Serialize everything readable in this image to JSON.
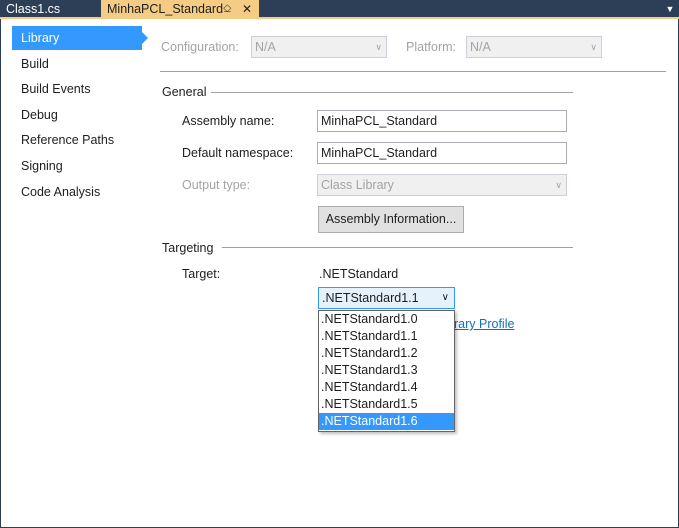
{
  "tabs": [
    {
      "label": "Class1.cs",
      "active": false
    },
    {
      "label": "MinhaPCL_Standard",
      "active": true
    }
  ],
  "icons": {
    "pin": "pin-icon",
    "close": "close-icon",
    "overflow": "chevron-down-icon"
  },
  "sidebar": {
    "items": [
      {
        "label": "Library",
        "selected": true
      },
      {
        "label": "Build"
      },
      {
        "label": "Build Events"
      },
      {
        "label": "Debug"
      },
      {
        "label": "Reference Paths"
      },
      {
        "label": "Signing"
      },
      {
        "label": "Code Analysis"
      }
    ]
  },
  "config": {
    "configuration_label": "Configuration:",
    "configuration_value": "N/A",
    "platform_label": "Platform:",
    "platform_value": "N/A"
  },
  "general": {
    "heading": "General",
    "assembly_name_label": "Assembly name:",
    "assembly_name_value": "MinhaPCL_Standard",
    "default_namespace_label": "Default namespace:",
    "default_namespace_value": "MinhaPCL_Standard",
    "output_type_label": "Output type:",
    "output_type_value": "Class Library",
    "assembly_info_button": "Assembly Information..."
  },
  "targeting": {
    "heading": "Targeting",
    "target_label": "Target:",
    "target_value": ".NETStandard",
    "target_version_selected": ".NETStandard1.1",
    "library_profile_link": "rary Profile",
    "dropdown_options": [
      ".NETStandard1.0",
      ".NETStandard1.1",
      ".NETStandard1.2",
      ".NETStandard1.3",
      ".NETStandard1.4",
      ".NETStandard1.5",
      ".NETStandard1.6"
    ],
    "highlighted_index": 6
  },
  "colors": {
    "tabstrip": "#2d3e57",
    "active_tab": "#f5cc84",
    "selection": "#3399ff",
    "link": "#0e70c0"
  }
}
